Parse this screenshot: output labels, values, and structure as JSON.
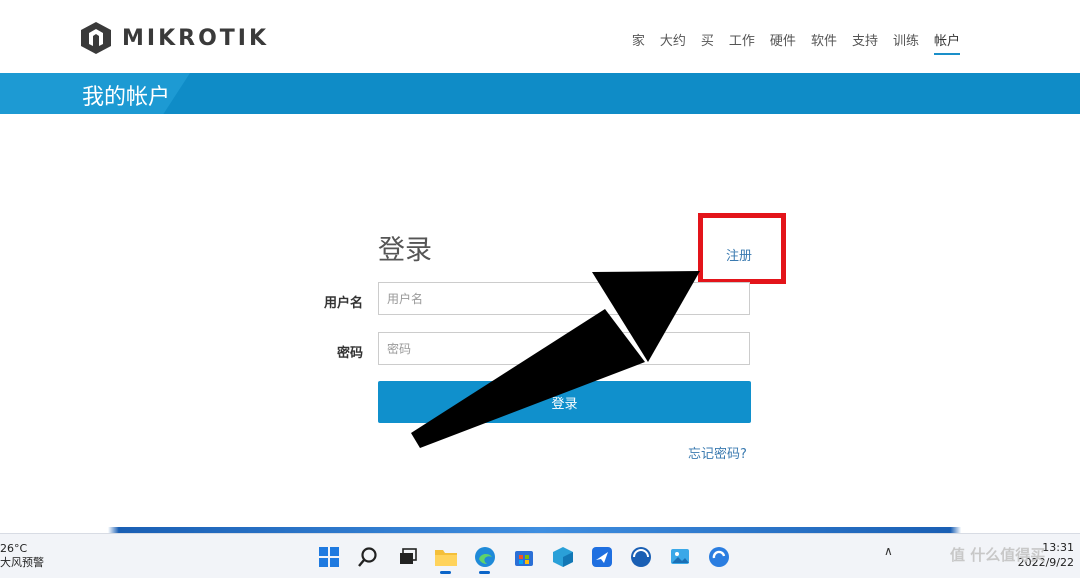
{
  "header": {
    "brand": "MIKROTIK",
    "nav": [
      {
        "label": "家",
        "active": false
      },
      {
        "label": "大约",
        "active": false
      },
      {
        "label": "买",
        "active": false
      },
      {
        "label": "工作",
        "active": false
      },
      {
        "label": "硬件",
        "active": false
      },
      {
        "label": "软件",
        "active": false
      },
      {
        "label": "支持",
        "active": false
      },
      {
        "label": "训练",
        "active": false
      },
      {
        "label": "帐户",
        "active": true
      }
    ]
  },
  "banner": {
    "title": "我的帐户"
  },
  "login": {
    "title": "登录",
    "register": "注册",
    "username_label": "用户名",
    "username_placeholder": "用户名",
    "password_label": "密码",
    "password_placeholder": "密码",
    "submit": "登录",
    "forgot": "忘记密码?"
  },
  "taskbar": {
    "weather_temp": "26°C",
    "weather_text": "大风预警",
    "clock_time": "13:31",
    "clock_date": "2022/9/22",
    "icons": [
      "windows-start-icon",
      "search-icon",
      "task-view-icon",
      "file-explorer-icon",
      "edge-browser-icon",
      "store-icon",
      "app-cube-icon",
      "feishu-icon",
      "browser-icon",
      "photos-icon",
      "app-swirl-icon"
    ]
  },
  "watermark": "值 什么值得买",
  "colors": {
    "accent": "#0f8cc7",
    "highlight": "#e3141a",
    "link": "#3a7ab0"
  }
}
